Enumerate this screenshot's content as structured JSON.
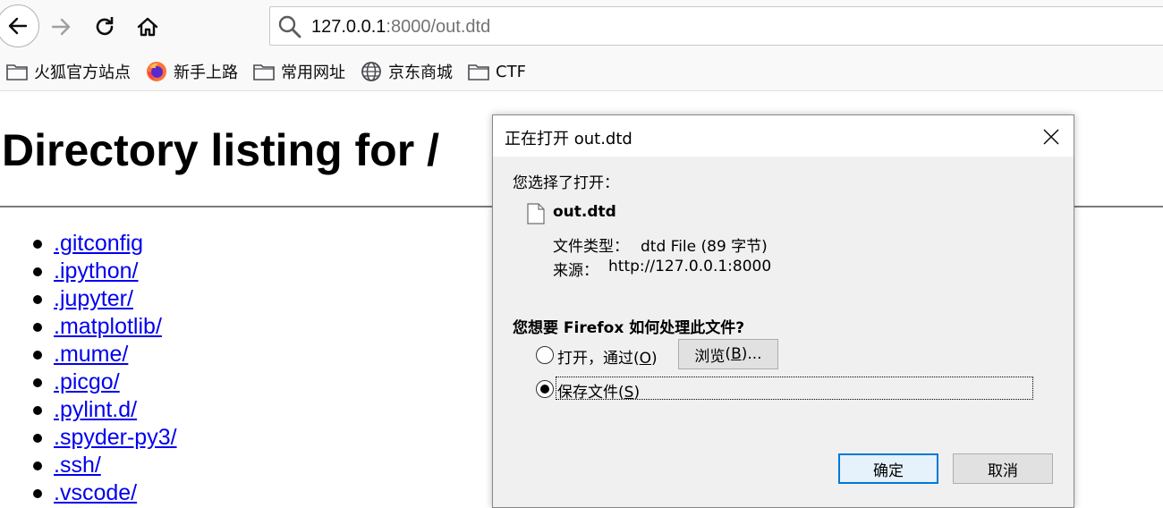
{
  "toolbar": {
    "url_host": "127.0.0.1",
    "url_rest": ":8000/out.dtd"
  },
  "bookmarks": [
    {
      "label": "火狐官方站点",
      "icon": "folder-icon"
    },
    {
      "label": "新手上路",
      "icon": "firefox-icon"
    },
    {
      "label": "常用网址",
      "icon": "folder-icon"
    },
    {
      "label": "京东商城",
      "icon": "globe-icon"
    },
    {
      "label": "CTF",
      "icon": "folder-icon"
    }
  ],
  "page": {
    "title": "Directory listing for /",
    "items": [
      ".gitconfig",
      ".ipython/",
      ".jupyter/",
      ".matplotlib/",
      ".mume/",
      ".picgo/",
      ".pylint.d/",
      ".spyder-py3/",
      ".ssh/",
      ".vscode/"
    ]
  },
  "dialog": {
    "title": "正在打开 out.dtd",
    "intro": "您选择了打开：",
    "filename": "out.dtd",
    "type_label": "文件类型：",
    "type_value": "dtd File (89 字节)",
    "source_label": "来源：",
    "source_value": "http://127.0.0.1:8000",
    "question": "您想要 Firefox 如何处理此文件?",
    "open_with": {
      "text": "打开，通过",
      "accel_open": "(",
      "accel": "O",
      "accel_close": ")",
      "selected": false
    },
    "browse": {
      "text": "浏览",
      "accel_open": "(",
      "accel": "B",
      "accel_close": ")..."
    },
    "save_file": {
      "text": "保存文件",
      "accel_open": "(",
      "accel": "S",
      "accel_close": ")",
      "selected": true
    },
    "ok_label": "确定",
    "cancel_label": "取消"
  },
  "colors": {
    "link": "#0000ee",
    "ok_border": "#0078d7",
    "dialog_bg": "#f0f0f0"
  }
}
